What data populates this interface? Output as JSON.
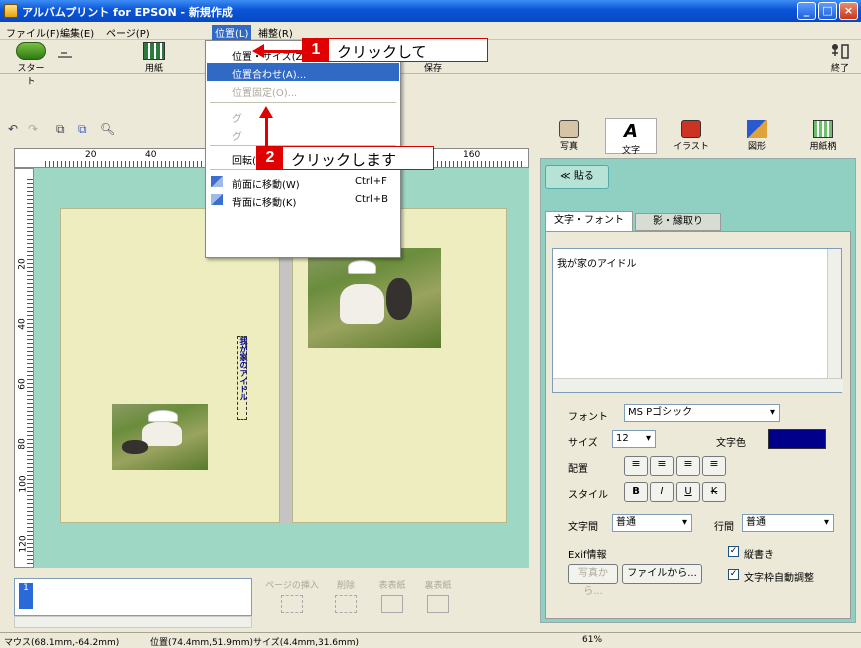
{
  "window": {
    "title": "アルバムプリント for EPSON - 新規作成"
  },
  "menubar": {
    "file": "ファイル(F)",
    "edit": "編集(E)",
    "page": "ページ(P)",
    "position": "位置(L)",
    "more": "補整(R)"
  },
  "toolbar": {
    "start": "スタート",
    "paper": "用紙",
    "save": "保存",
    "exit": "終了"
  },
  "menu": {
    "items": [
      {
        "label": "位置・サイズ(Z)...",
        "state": "normal"
      },
      {
        "label": "位置合わせ(A)...",
        "state": "selected"
      },
      {
        "label": "位置固定(O)...",
        "state": "disabled"
      },
      {
        "label": "グ",
        "state": "disabled"
      },
      {
        "label": "グ",
        "state": "disabled"
      },
      {
        "label": "回転(T)",
        "state": "normal"
      },
      {
        "label": "前面に移動(W)",
        "shortcut": "Ctrl+F",
        "state": "normal"
      },
      {
        "label": "背面に移動(K)",
        "shortcut": "Ctrl+B",
        "state": "normal"
      }
    ]
  },
  "callouts": [
    {
      "num": "1",
      "text": "クリックして"
    },
    {
      "num": "2",
      "text": "クリックします"
    }
  ],
  "ruler": {
    "t20": "20",
    "t40": "40",
    "t160": "160",
    "l20": "20",
    "l40": "40",
    "l60": "60",
    "l80": "80",
    "l100": "100",
    "l120": "120"
  },
  "canvas": {
    "vertical_text": "我が家のアイドル"
  },
  "right_panel": {
    "tabs": [
      "写真",
      "文字",
      "イラスト",
      "図形",
      "用紙柄"
    ],
    "paste": "≪ 貼る",
    "subtabs": [
      "文字・フォント",
      "影・縁取り"
    ],
    "text_content": "我が家のアイドル",
    "font_label": "フォント",
    "font_value": "MS Pゴシック",
    "size_label": "サイズ",
    "size_value": "12",
    "color_label": "文字色",
    "align_label": "配置",
    "style_label": "スタイル",
    "style_buttons": [
      "B",
      "I",
      "U",
      "K"
    ],
    "char_spacing_label": "文字間",
    "char_spacing_value": "普通",
    "line_spacing_label": "行間",
    "line_spacing_value": "普通",
    "exif_label": "Exif情報",
    "vertical_label": "縦書き",
    "from_photo": "写真から...",
    "from_file": "ファイルから...",
    "auto_adjust": "文字枠自動調整"
  },
  "bottom": {
    "insert_page": "ページの挿入",
    "delete": "削除",
    "front_cover": "表表紙",
    "back_cover": "裏表紙",
    "page_num": "1"
  },
  "status": {
    "mouse": "マウス(68.1mm,-64.2mm)",
    "pos": "位置(74.4mm,51.9mm)サイズ(4.4mm,31.6mm)",
    "zoom": "61%"
  },
  "colors": {
    "accent": "#316AC5",
    "callout_red": "#E00000",
    "text_color": "#000080"
  }
}
